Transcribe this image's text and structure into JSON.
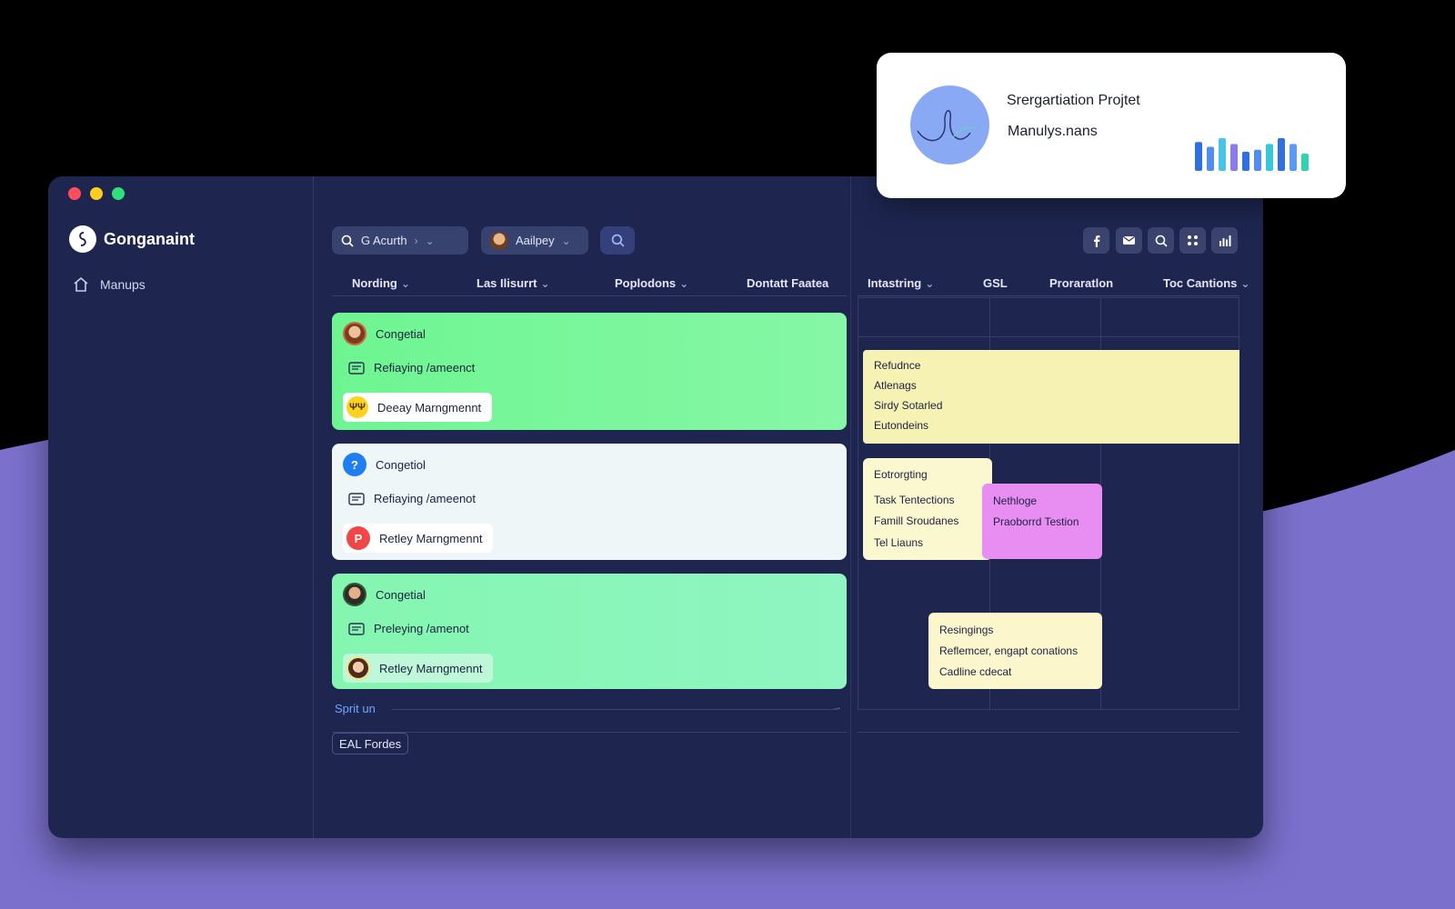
{
  "app": {
    "brand": "Gonganaint",
    "nav": [
      {
        "label": "Manups",
        "icon": "home-icon"
      }
    ]
  },
  "toolbar": {
    "search_label": "G Acurth",
    "user_label": "Aailpey",
    "icons": [
      "facebook-icon",
      "mail-icon",
      "search-icon",
      "grid-icon",
      "bar-chart-icon"
    ]
  },
  "columns": [
    "Nording",
    "Las Ilisurrt",
    "Poplodons",
    "Dontatt Faatea",
    "Intastring",
    "GSL",
    "Proraratlon",
    "Toc Cantions"
  ],
  "groups": [
    {
      "color": "#76f59b",
      "rows": [
        "Congetial",
        "Refiaying /ameenct",
        "Deeay Marngmennt"
      ],
      "badge": "ΨΨ"
    },
    {
      "color": "#eef6f8",
      "rows": [
        "Congetiol",
        "Refiaying /ameenot",
        "Retley Marngmennt"
      ],
      "badge_top": "?",
      "badge": "P"
    },
    {
      "color": "#8af6b8",
      "rows": [
        "Congetial",
        "Preleying /amenot",
        "Retley Marngmennt"
      ]
    }
  ],
  "split_label": "Sprit un",
  "filter_label": "EAL Fordes",
  "board_notes": [
    {
      "lines": [
        "Refudnce",
        "Atlenags",
        "Sirdy Sotarled",
        "Eutondeins"
      ],
      "color": "#f6f2b4"
    },
    {
      "lines": [
        "Eotrorgting",
        "Task Tentections",
        "Famill Sroudanes",
        "Tel Liauns"
      ],
      "color": "#fbf7cf"
    },
    {
      "lines": [
        "Nethloge",
        "Praoborrd Testion"
      ],
      "color": "#e88ef2"
    },
    {
      "lines": [
        "Resingings",
        "Reflemcer, engapt conations",
        "Cadline cdecat"
      ],
      "color": "#fbf6cc"
    }
  ],
  "float_card": {
    "title": "Srergartiation Projtet",
    "subtitle": "Manulys.nans",
    "mini_chart_values": [
      30,
      25,
      34,
      28,
      20,
      22,
      28,
      34,
      28,
      18
    ]
  },
  "colors": {
    "window": "#1e2650",
    "accent_blue": "#6ea6ff",
    "background_wave": "#7b70cc"
  }
}
